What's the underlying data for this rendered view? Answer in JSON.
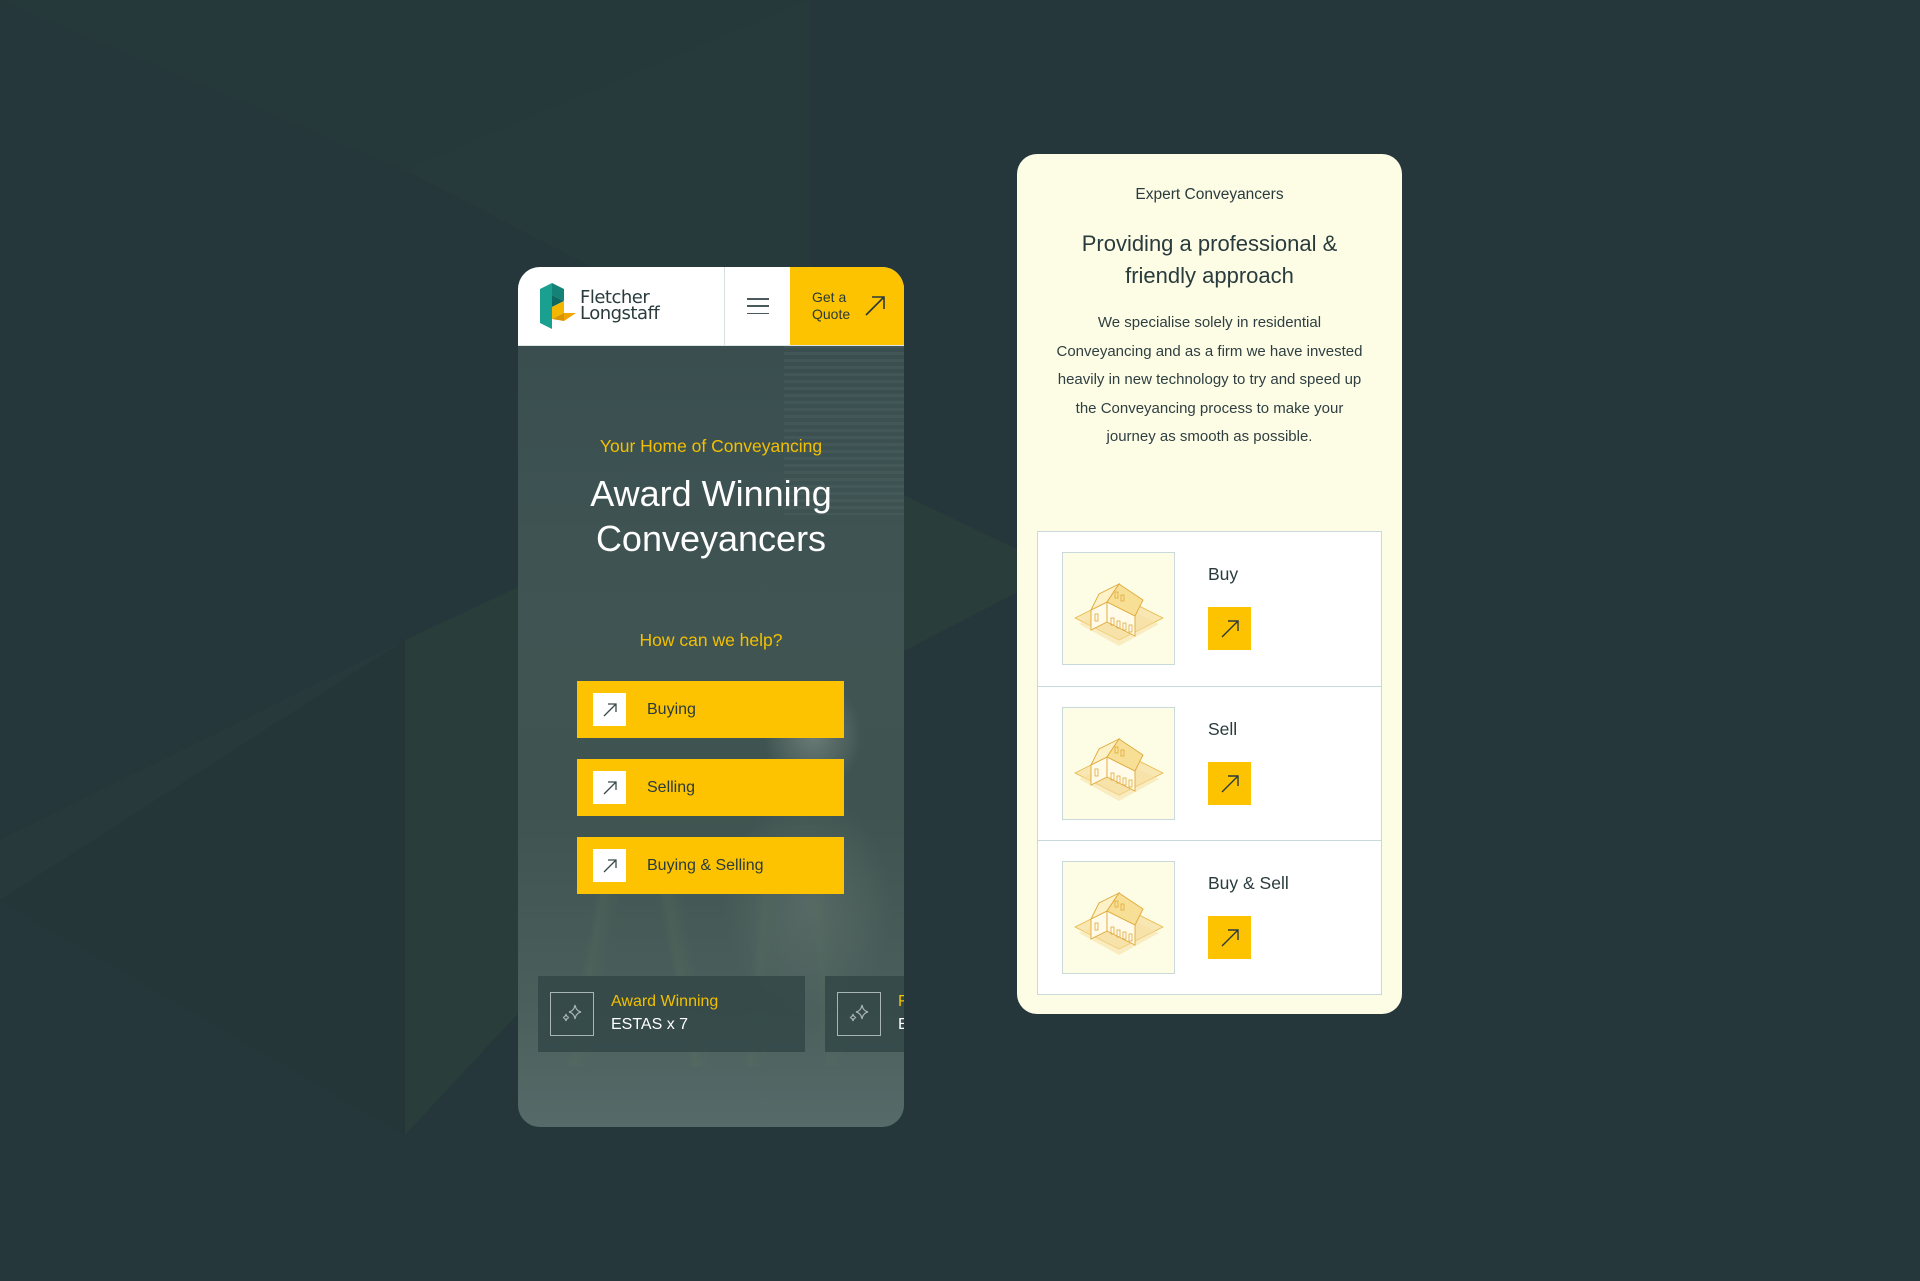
{
  "colors": {
    "background": "#25373a",
    "accent_yellow": "#fdc300",
    "cream": "#fdfde6",
    "text_dark": "#2a3b3d",
    "logo_teal": "#1aa091",
    "logo_orange": "#f0a500"
  },
  "left_mobile": {
    "header": {
      "logo": {
        "line1": "Fletcher",
        "line2": "Longstaff",
        "icon": "fletcher-longstaff-logo"
      },
      "menu_icon": "hamburger-icon",
      "quote_button": {
        "line1": "Get a",
        "line2": "Quote",
        "icon": "arrow-up-right-icon"
      }
    },
    "hero": {
      "eyebrow": "Your Home of Conveyancing",
      "title_line1": "Award Winning",
      "title_line2": "Conveyancers",
      "help_label": "How can we help?"
    },
    "options": [
      {
        "label": "Buying",
        "icon": "arrow-up-right-icon"
      },
      {
        "label": "Selling",
        "icon": "arrow-up-right-icon"
      },
      {
        "label": "Buying & Selling",
        "icon": "arrow-up-right-icon"
      }
    ],
    "awards": [
      {
        "title": "Award Winning",
        "subtitle": "ESTAS x 7",
        "icon": "sparkle-icon"
      },
      {
        "title": "F",
        "subtitle": "E",
        "icon": "sparkle-icon"
      }
    ]
  },
  "right_mobile": {
    "tag": "Expert Conveyancers",
    "title_line1": "Providing a professional &",
    "title_line2": "friendly approach",
    "body": "We specialise solely in residential Conveyancing and as a firm we have invested heavily in new technology to try and speed up the Conveyancing process to make your journey as smooth as possible.",
    "services": [
      {
        "label": "Buy",
        "icon": "arrow-up-right-icon",
        "image": "isometric-house-illustration"
      },
      {
        "label": "Sell",
        "icon": "arrow-up-right-icon",
        "image": "isometric-house-illustration"
      },
      {
        "label": "Buy & Sell",
        "icon": "arrow-up-right-icon",
        "image": "isometric-house-illustration"
      }
    ]
  }
}
